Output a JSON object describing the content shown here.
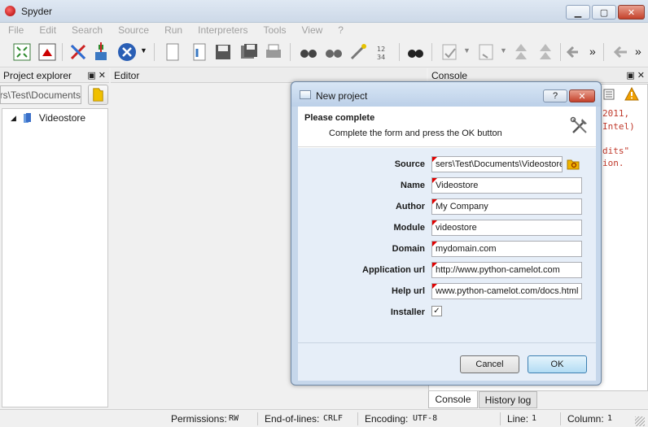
{
  "window": {
    "title": "Spyder",
    "min": "▁",
    "max": "▢",
    "close": "✕"
  },
  "menu": [
    "File",
    "Edit",
    "Search",
    "Source",
    "Run",
    "Interpreters",
    "Tools",
    "View",
    "?"
  ],
  "toolbar": {
    "overflow1": "»",
    "overflow2": "»"
  },
  "project_explorer": {
    "title": "Project explorer",
    "path": "sers\\Test\\Documents",
    "tree_item": "Videostore"
  },
  "editor": {
    "title": "Editor"
  },
  "console": {
    "title": "Console",
    "lines": [
      "2011,",
      "Intel)",
      "dits\"",
      "ion."
    ],
    "tabs": [
      "Console",
      "History log"
    ]
  },
  "status": {
    "permissions_label": "Permissions:",
    "permissions_value": "RW",
    "eol_label": "End-of-lines:",
    "eol_value": "CRLF",
    "encoding_label": "Encoding:",
    "encoding_value": "UTF-8",
    "line_label": "Line:",
    "line_value": "1",
    "column_label": "Column:",
    "column_value": "1"
  },
  "dialog": {
    "title": "New project",
    "help": "?",
    "close": "✕",
    "heading": "Please complete",
    "subheading": "Complete the form and press the OK button",
    "fields": [
      {
        "label": "Source",
        "value": "sers\\Test\\Documents\\Videostore"
      },
      {
        "label": "Name",
        "value": "Videostore"
      },
      {
        "label": "Author",
        "value": "My Company"
      },
      {
        "label": "Module",
        "value": "videostore"
      },
      {
        "label": "Domain",
        "value": "mydomain.com"
      },
      {
        "label": "Application url",
        "value": "http://www.python-camelot.com"
      },
      {
        "label": "Help url",
        "value": "www.python-camelot.com/docs.html"
      }
    ],
    "installer_label": "Installer",
    "installer_checked": true,
    "cancel": "Cancel",
    "ok": "OK"
  },
  "colors": {
    "accent": "#3c7fb1",
    "required_marker": "#e00000",
    "console_text": "#c0392b"
  }
}
